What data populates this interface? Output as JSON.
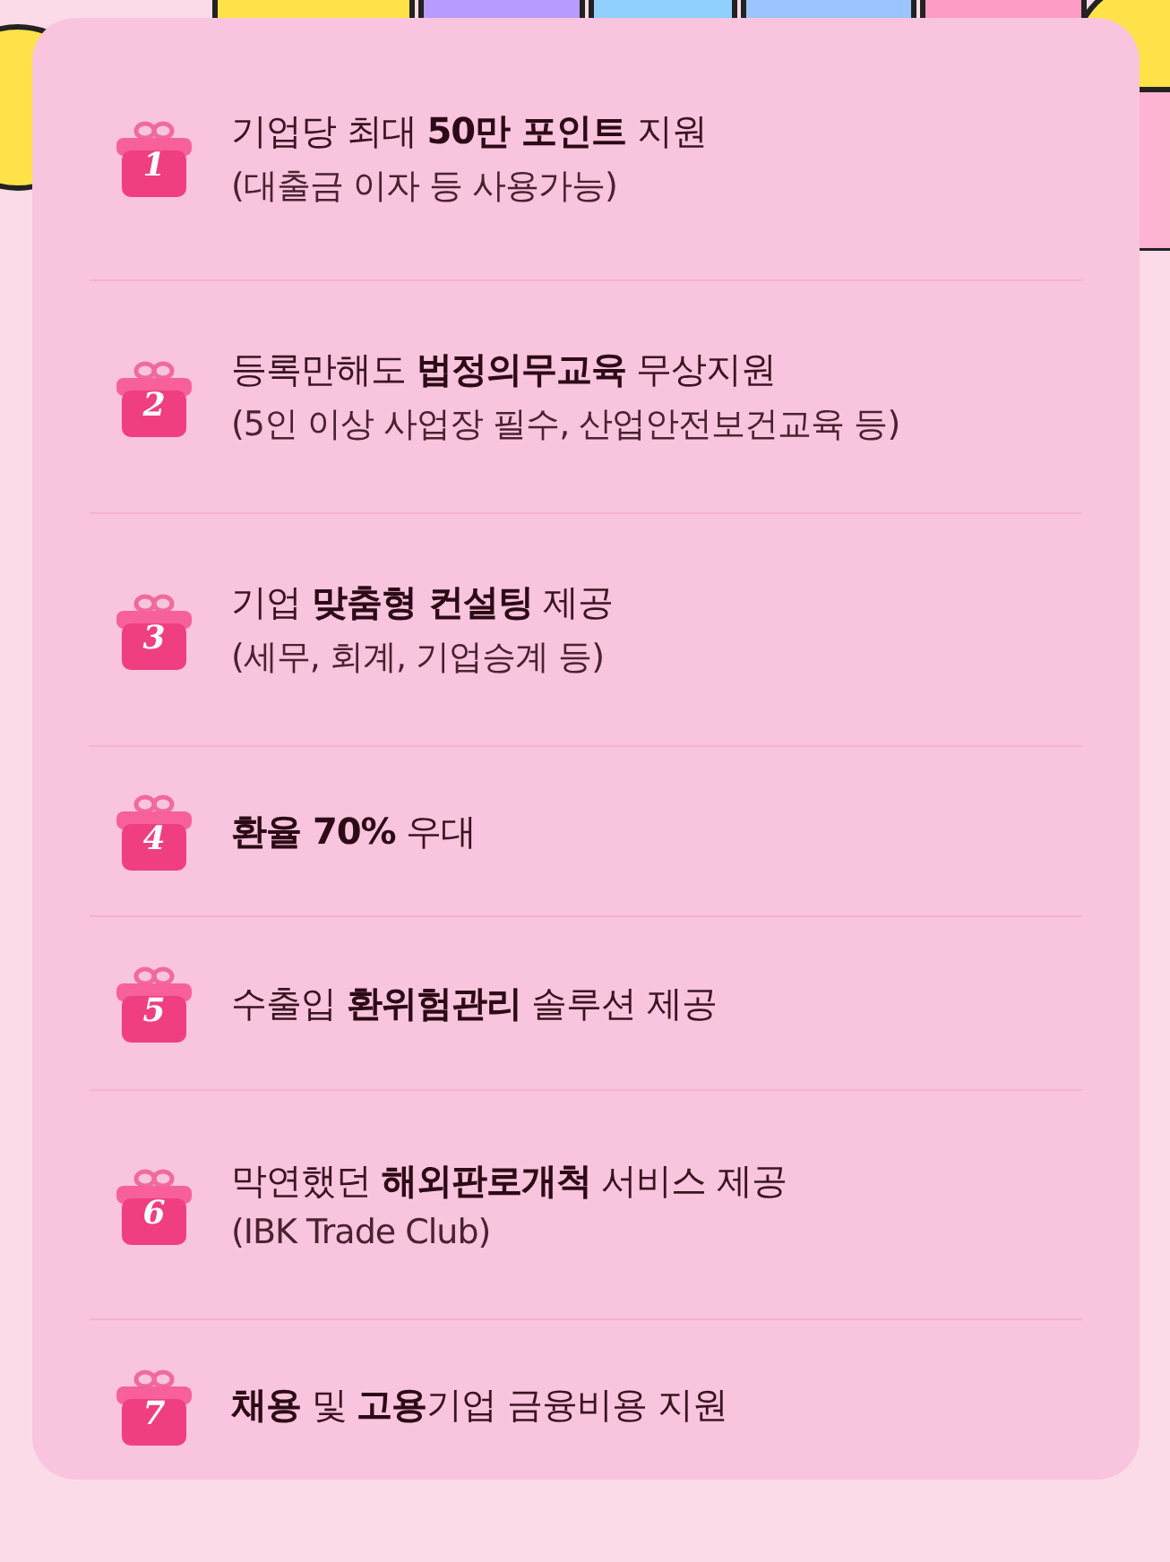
{
  "benefits": [
    {
      "number": "1",
      "title": "기업당 최대 **50만 포인트** 지원",
      "note": "(대출금 이자 등 사용가능)"
    },
    {
      "number": "2",
      "title": "등록만해도 **법정의무교육** 무상지원",
      "note": "(5인 이상 사업장 필수, 산업안전보건교육 등)"
    },
    {
      "number": "3",
      "title": "기업 **맞춤형 컨설팅** 제공",
      "note": "(세무, 회계, 기업승계 등)"
    },
    {
      "number": "4",
      "title": "**환율 70%** 우대"
    },
    {
      "number": "5",
      "title": "수출입 **환위험관리** 솔루션 제공"
    },
    {
      "number": "6",
      "title": "막연했던 **해외판로개척** 서비스 제공",
      "note": "(IBK Trade Club)"
    },
    {
      "number": "7",
      "title": "**채용** 및 **고용**기업 금융비용 지원"
    }
  ]
}
